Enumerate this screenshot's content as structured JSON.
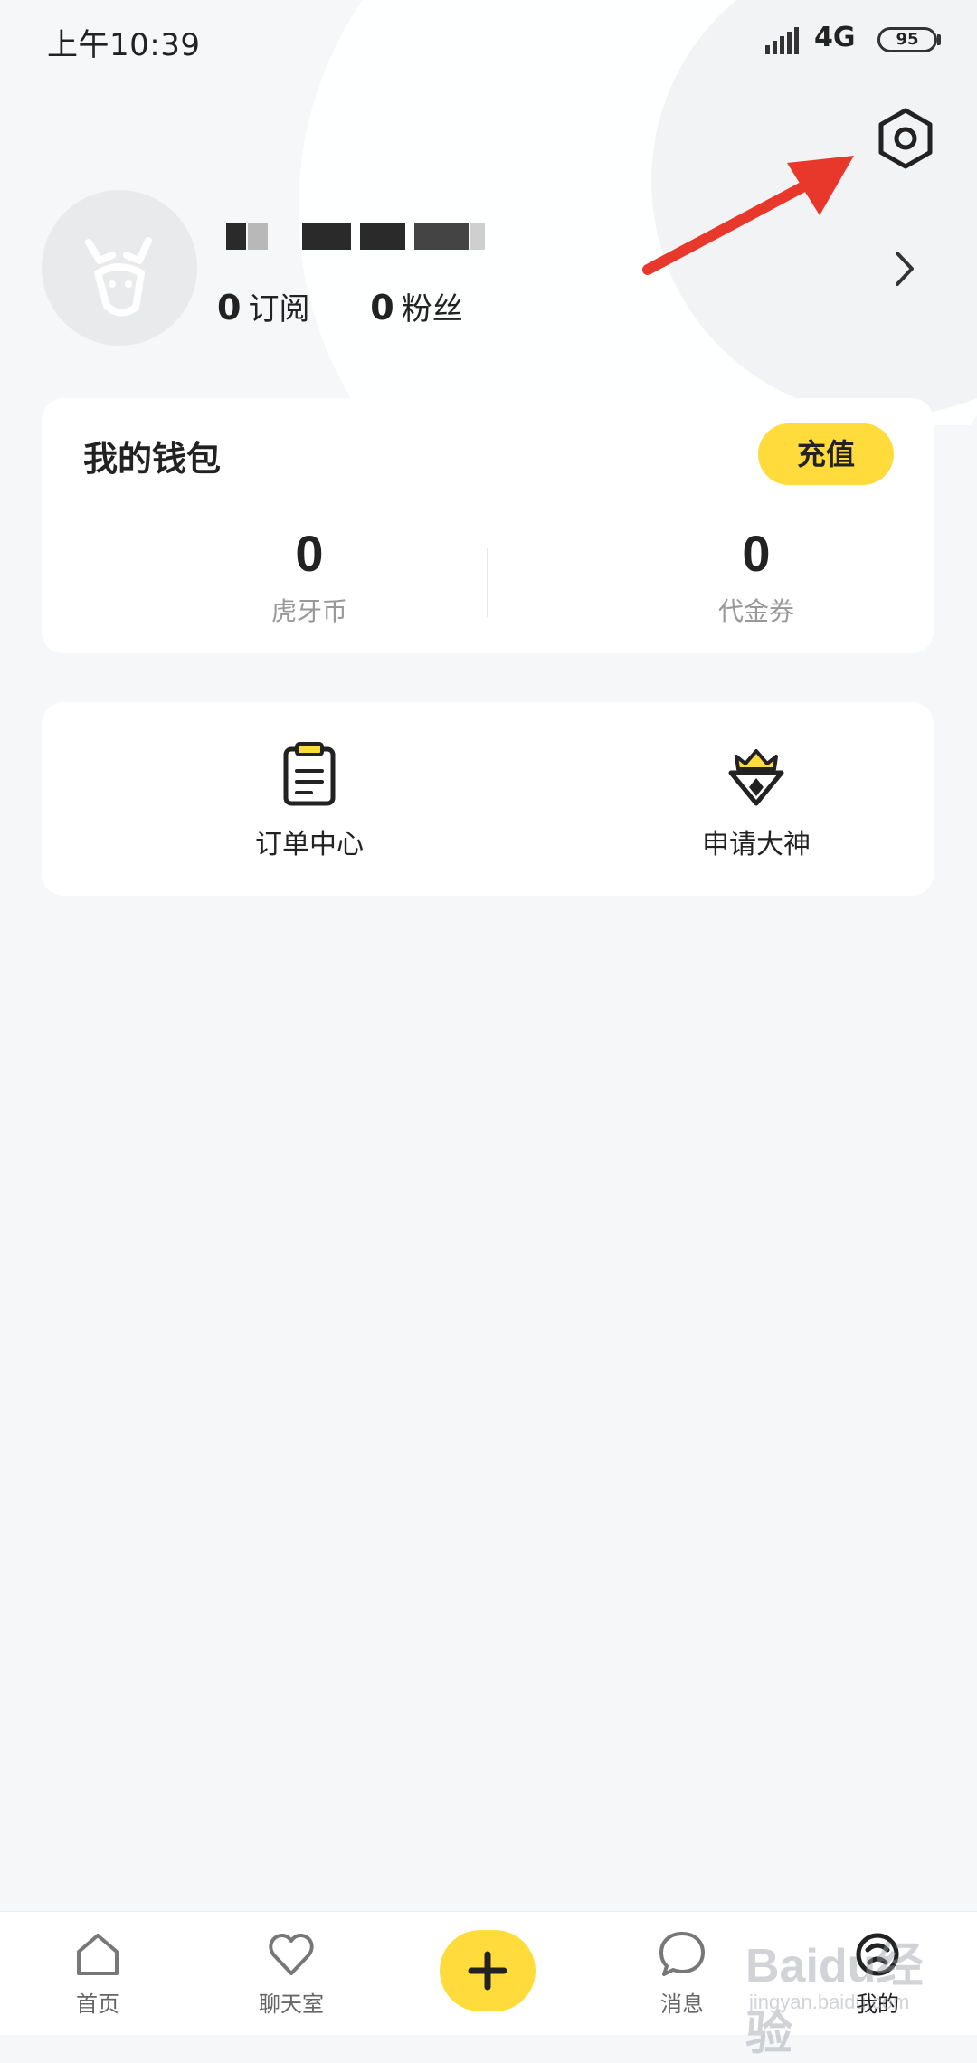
{
  "status_bar": {
    "time": "上午10:39",
    "network": "4G",
    "battery": "95"
  },
  "profile": {
    "subscriptions": {
      "count": "0",
      "label": "订阅"
    },
    "followers": {
      "count": "0",
      "label": "粉丝"
    }
  },
  "wallet": {
    "title": "我的钱包",
    "recharge_label": "充值",
    "items": [
      {
        "value": "0",
        "label": "虎牙币"
      },
      {
        "value": "0",
        "label": "代金券"
      }
    ]
  },
  "services": {
    "items": [
      {
        "label": "订单中心",
        "icon": "clipboard-icon"
      },
      {
        "label": "申请大神",
        "icon": "crown-shield-icon"
      }
    ]
  },
  "bottom_nav": {
    "items": [
      {
        "label": "首页",
        "icon": "home-icon"
      },
      {
        "label": "聊天室",
        "icon": "heart-icon"
      },
      {
        "label": "",
        "icon": "plus-icon"
      },
      {
        "label": "消息",
        "icon": "chat-bubble-icon"
      },
      {
        "label": "我的",
        "icon": "profile-icon",
        "active": true
      }
    ]
  },
  "watermark": {
    "logo": "Baidu经验",
    "url": "jingyan.baidu.com"
  },
  "colors": {
    "accent": "#ffdc3c",
    "annotation": "#e8382c",
    "background": "#f6f7f9"
  }
}
